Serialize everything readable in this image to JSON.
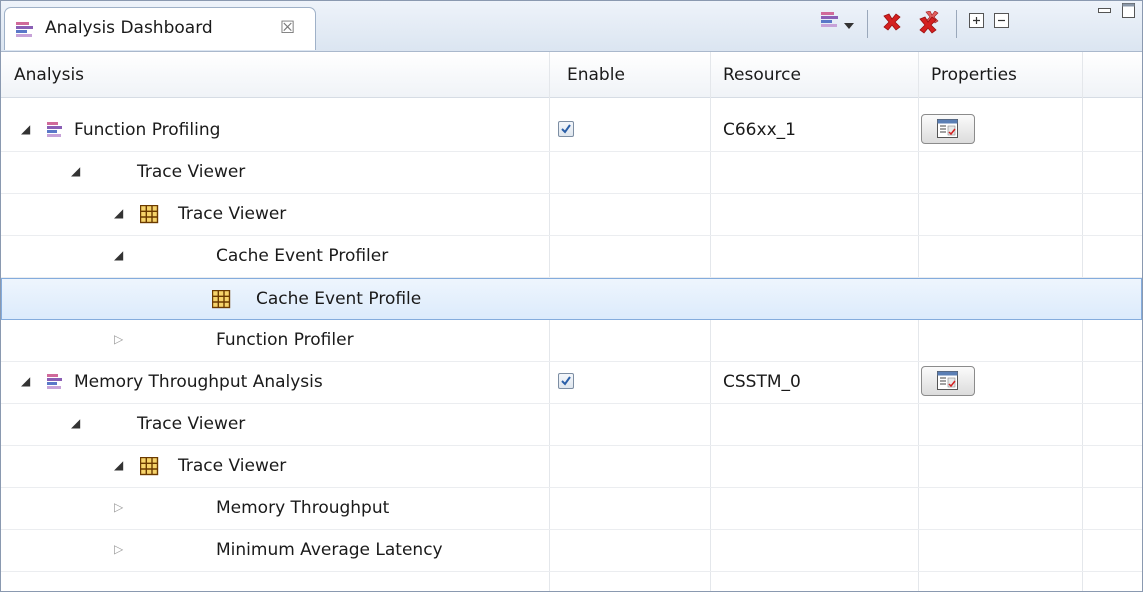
{
  "tab": {
    "title": "Analysis Dashboard",
    "close_glyph": "☒"
  },
  "toolbar": {
    "icons": [
      "analysis-menu-icon",
      "dropdown-arrow-icon",
      "remove-icon",
      "remove-all-icon",
      "expand-all-icon",
      "collapse-all-icon",
      "minimize-icon",
      "maximize-icon"
    ]
  },
  "columns": [
    "Analysis",
    "Enable",
    "Resource",
    "Properties"
  ],
  "rows": [
    {
      "label": "Function Profiling",
      "level": 0,
      "twisty": "open",
      "icon": "analysis-icon",
      "enabled": true,
      "resource": "C66xx_1",
      "has_properties": true
    },
    {
      "label": "Trace Viewer",
      "level": 1,
      "twisty": "open",
      "icon": "none"
    },
    {
      "label": "Trace Viewer",
      "level": 1,
      "twisty": "open",
      "icon": "table-icon"
    },
    {
      "label": "Cache Event Profiler",
      "level": 2,
      "twisty": "open",
      "icon": "none"
    },
    {
      "label": "Cache Event Profile",
      "level": 3,
      "twisty": "none",
      "icon": "table-icon",
      "selected": true
    },
    {
      "label": "Function Profiler",
      "level": 2,
      "twisty": "closed",
      "icon": "none"
    },
    {
      "label": "Memory Throughput  Analysis",
      "level": 0,
      "twisty": "open",
      "icon": "analysis-icon",
      "enabled": true,
      "resource": "CSSTM_0",
      "has_properties": true
    },
    {
      "label": "Trace Viewer",
      "level": 1,
      "twisty": "open",
      "icon": "none"
    },
    {
      "label": "Trace Viewer",
      "level": 1,
      "twisty": "open",
      "icon": "table-icon"
    },
    {
      "label": "Memory Throughput",
      "level": 2,
      "twisty": "closed",
      "icon": "none"
    },
    {
      "label": "Minimum Average Latency",
      "level": 2,
      "twisty": "closed",
      "icon": "none"
    }
  ],
  "colors": {
    "selection": "#dcebfc",
    "selection_border": "#84acdd",
    "remove_red": "#d42020",
    "analysis_icon_purple": "#8a5fb5",
    "table_icon_brown": "#6b3a00"
  }
}
